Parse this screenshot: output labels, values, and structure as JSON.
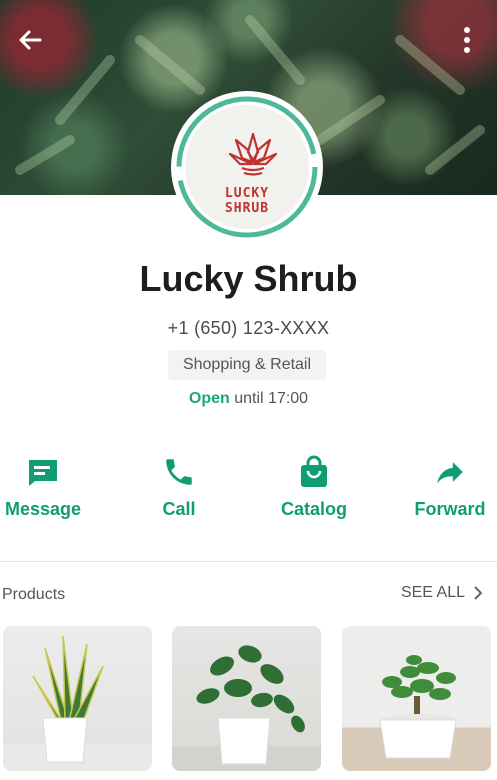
{
  "business": {
    "name": "Lucky Shrub",
    "phone": "+1 (650) 123-XXXX",
    "category": "Shopping & Retail",
    "status_open": "Open",
    "status_until": " until 17:00",
    "logo_line1": "LUCKY",
    "logo_line2": "SHRUB"
  },
  "actions": {
    "message": "Message",
    "call": "Call",
    "catalog": "Catalog",
    "forward": "Forward"
  },
  "products": {
    "title": "Products",
    "see_all": "SEE ALL"
  },
  "colors": {
    "accent": "#0f9e74",
    "logo_red": "#c0312f",
    "ring": "#4db89a"
  },
  "icons": [
    "back-arrow-icon",
    "more-vertical-icon",
    "message-icon",
    "phone-icon",
    "shopping-bag-icon",
    "forward-icon",
    "chevron-right-icon"
  ]
}
